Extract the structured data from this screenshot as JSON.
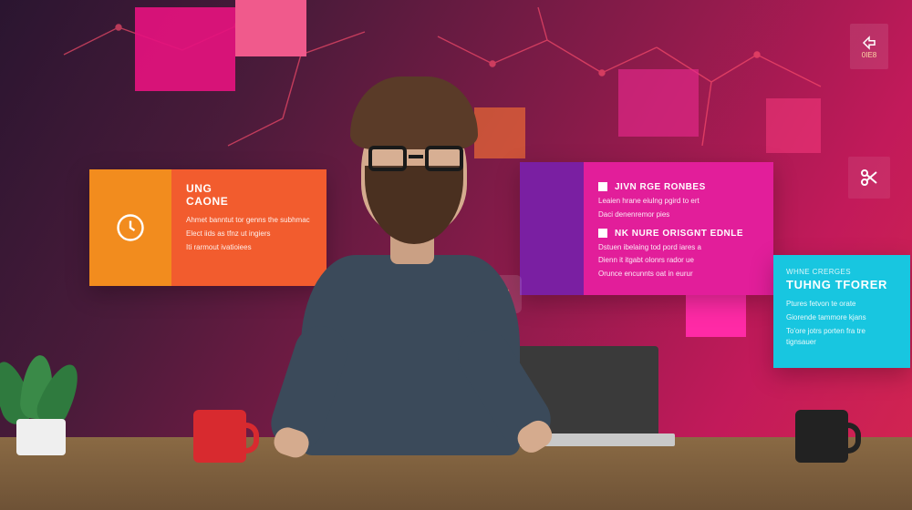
{
  "colors": {
    "orange": "#f28c1e",
    "deep_orange": "#f25c2e",
    "purple": "#7a1fa2",
    "magenta": "#e21e9a",
    "cyan": "#18c6e0",
    "bg_start": "#2a1530",
    "bg_end": "#d4264f"
  },
  "left_card": {
    "title_line1": "UNG",
    "title_line2": "CAONE",
    "lines": [
      "Ahmet banntut tor genns the subhmac",
      "Elect iids as tfnz ut ingiers",
      "Iti rarmout ivatioiees"
    ]
  },
  "center_card": {
    "heading1": "JIVN RGE RONBES",
    "lines1": [
      "Leaien hrane eiulng pgird to ert",
      "Daci denenremor pies"
    ],
    "heading2": "NK NURE ORISGNT EDNLE",
    "lines2": [
      "Dstuen ibelaing tod pord iares a",
      "Dienn it itgabt olonrs rador ue",
      "Orunce encunnts oat in eurur"
    ]
  },
  "right_card": {
    "eyebrow": "WHNE CRERGES",
    "title": "TUHNG TFORER",
    "lines": [
      "Ptures fetvon te orate",
      "Giorende tammore kjans",
      "To'ore jotrs porten fra tre tignsauer"
    ]
  },
  "top_right_badge": "0IE8",
  "icons": {
    "clock": "clock-icon",
    "share": "share-icon",
    "scissors": "scissors-icon",
    "tools": "tools-icon"
  }
}
